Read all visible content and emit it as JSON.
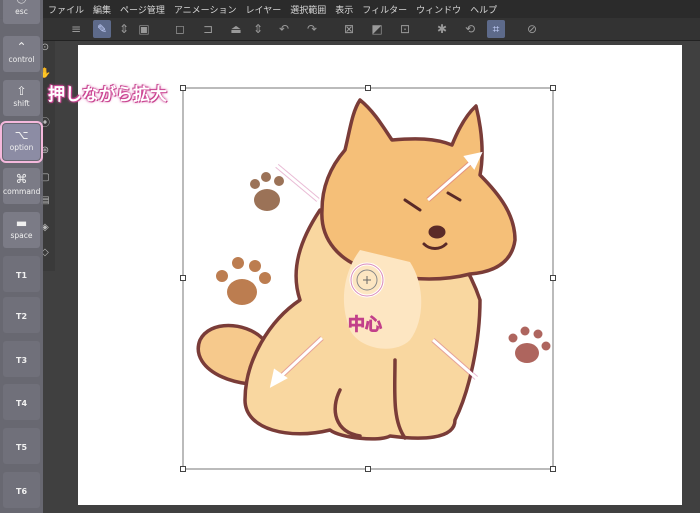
{
  "menu": {
    "items": [
      "ファイル",
      "編集",
      "ページ管理",
      "アニメーション",
      "レイヤー",
      "選択範囲",
      "表示",
      "フィルター",
      "ウィンドウ",
      "ヘルプ"
    ]
  },
  "keyboard": {
    "esc": "esc",
    "control": "control",
    "shift": "shift",
    "option": "option",
    "command": "command",
    "space": "space",
    "t1": "T1",
    "t2": "T2",
    "t3": "T3",
    "t4": "T4",
    "t5": "T5",
    "t6": "T6"
  },
  "overlay": {
    "caption": "押しながら拡大",
    "center_label": "中心"
  },
  "colors": {
    "accent_highlight": "#f4b8dc",
    "caption_outline": "#c2408a",
    "canvas": "#ffffff"
  }
}
